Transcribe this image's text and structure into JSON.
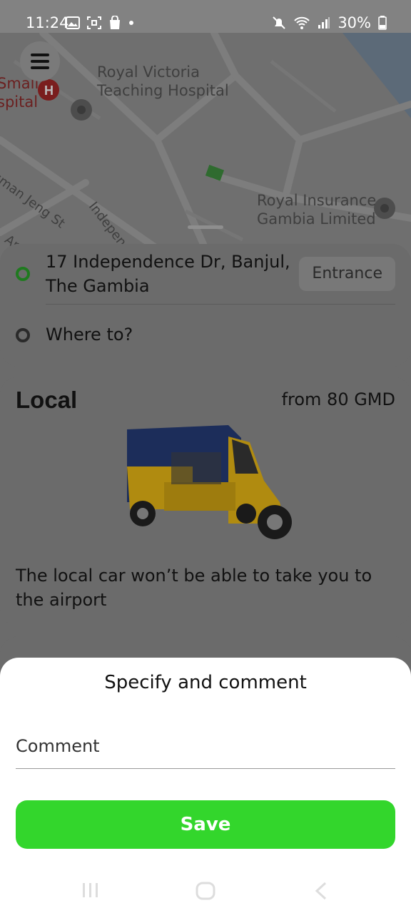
{
  "status_bar": {
    "time": "11:24",
    "battery": "30%"
  },
  "map": {
    "labels": [
      {
        "text": "Royal Victoria\nTeaching Hospital"
      },
      {
        "text": "Small\nspital"
      },
      {
        "text": "Royal Insurance\nGambia Limited"
      },
      {
        "text": "Independence"
      },
      {
        "text": "sman Jeng St"
      },
      {
        "text": "An"
      }
    ]
  },
  "route": {
    "from": "17 Independence Dr, Banjul, The Gambia",
    "to_placeholder": "Where to?",
    "entrance_label": "Entrance"
  },
  "tariff": {
    "name": "Local",
    "price": "from 80 GMD",
    "note": "The local car won’t be able to take you to the airport",
    "vehicle_icon": "tuk-tuk-icon"
  },
  "sheet": {
    "title": "Specify and comment",
    "comment_placeholder": "Comment",
    "comment_value": "",
    "save_label": "Save"
  },
  "colors": {
    "accent": "#33d62c",
    "pickup_dot": "#1f7a1f"
  }
}
